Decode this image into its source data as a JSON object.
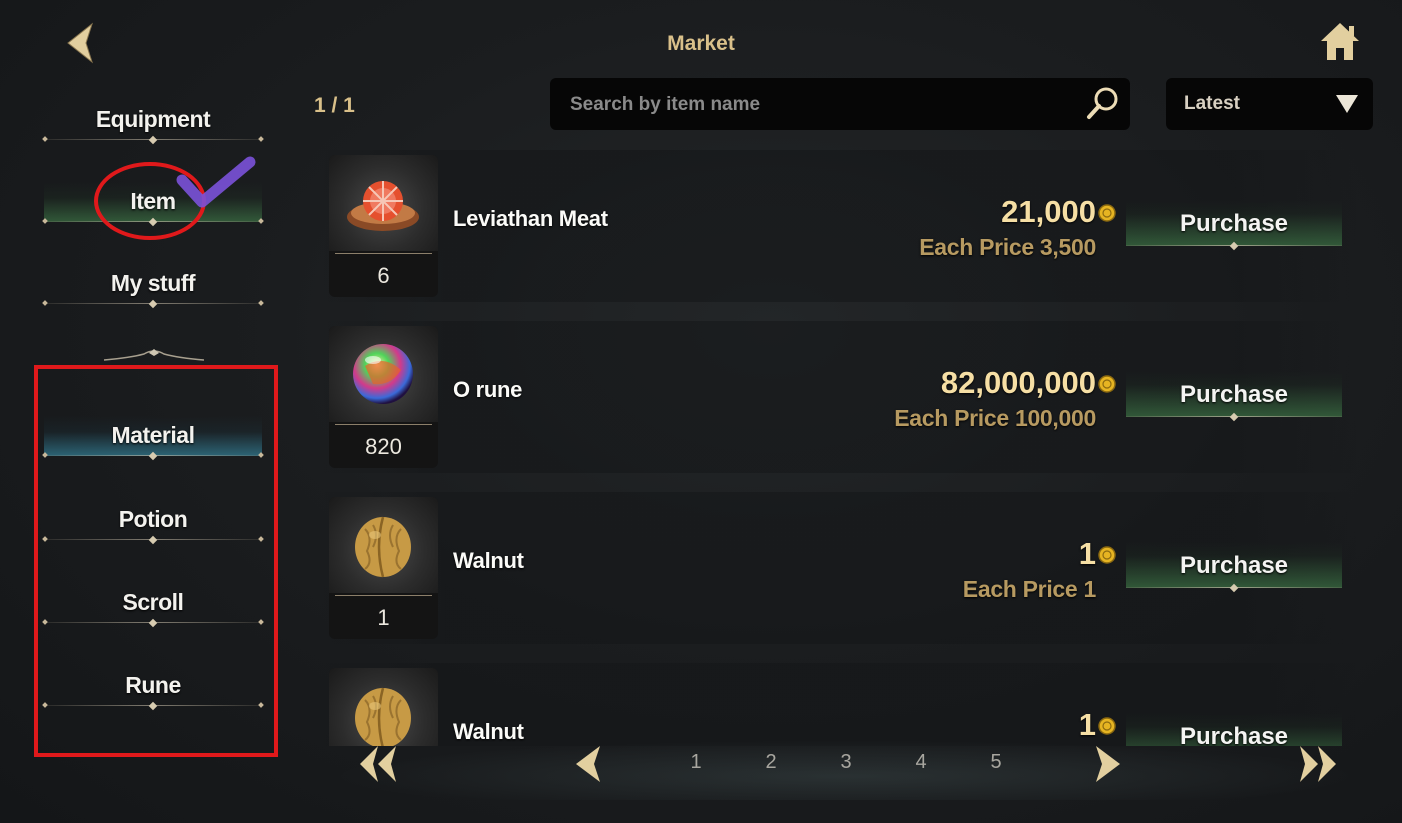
{
  "header": {
    "title": "Market"
  },
  "sidebar": {
    "tabs": [
      {
        "label": "Equipment"
      },
      {
        "label": "Item"
      },
      {
        "label": "My stuff"
      }
    ],
    "categories": [
      {
        "label": "Material"
      },
      {
        "label": "Potion"
      },
      {
        "label": "Scroll"
      },
      {
        "label": "Rune"
      }
    ]
  },
  "toolbar": {
    "page_count": "1 / 1",
    "search_placeholder": "Search by item name",
    "sort_label": "Latest"
  },
  "items": [
    {
      "name": "Leviathan Meat",
      "qty": "6",
      "price": "21,000",
      "each_price": "Each Price 3,500",
      "button": "Purchase",
      "icon": "meat-icon"
    },
    {
      "name": "O rune",
      "qty": "820",
      "price": "82,000,000",
      "each_price": "Each Price 100,000",
      "button": "Purchase",
      "icon": "rune-orb-icon"
    },
    {
      "name": "Walnut",
      "qty": "1",
      "price": "1",
      "each_price": "Each Price 1",
      "button": "Purchase",
      "icon": "walnut-icon"
    },
    {
      "name": "Walnut",
      "qty": "",
      "price": "1",
      "each_price": "",
      "button": "Purchase",
      "icon": "walnut-icon"
    }
  ],
  "pagination": {
    "pages": [
      "1",
      "2",
      "3",
      "4",
      "5"
    ]
  },
  "colors": {
    "gold": "#d9c08a",
    "price": "#f6dfa5",
    "each_price": "#b79a61",
    "annotation_red": "#e0191b",
    "check_purple": "#7b52d9"
  }
}
